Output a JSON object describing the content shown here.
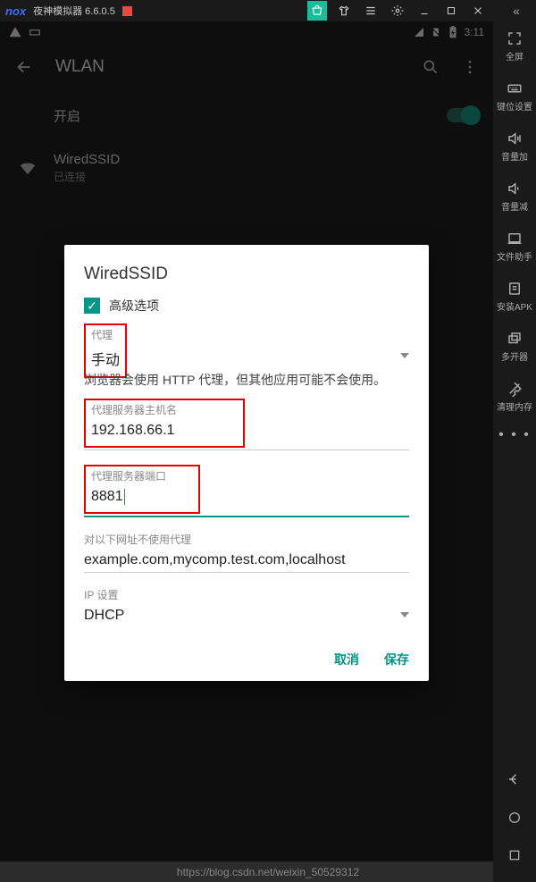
{
  "titlebar": {
    "brand": "nox",
    "title": "夜神模拟器 6.6.0.5"
  },
  "statusbar": {
    "time": "3:11"
  },
  "appbar": {
    "title": "WLAN"
  },
  "toggle": {
    "label": "开启"
  },
  "wifi_item": {
    "ssid": "WiredSSID",
    "status": "已连接"
  },
  "modal": {
    "title": "WiredSSID",
    "advanced_label": "高级选项",
    "proxy_label": "代理",
    "proxy_value": "手动",
    "hint": "浏览器会使用 HTTP 代理，但其他应用可能不会使用。",
    "host_label": "代理服务器主机名",
    "host_value": "192.168.66.1",
    "port_label": "代理服务器端口",
    "port_value": "8881",
    "bypass_label": "对以下网址不使用代理",
    "bypass_placeholder": "example.com,mycomp.test.com,localhost",
    "ip_label": "IP 设置",
    "ip_value": "DHCP",
    "cancel": "取消",
    "save": "保存"
  },
  "sidebar": {
    "items": [
      {
        "label": "全屏"
      },
      {
        "label": "键位设置"
      },
      {
        "label": "音量加"
      },
      {
        "label": "音量减"
      },
      {
        "label": "文件助手"
      },
      {
        "label": "安装APK"
      },
      {
        "label": "多开器"
      },
      {
        "label": "清理内存"
      }
    ]
  },
  "watermark": "https://blog.csdn.net/weixin_50529312"
}
